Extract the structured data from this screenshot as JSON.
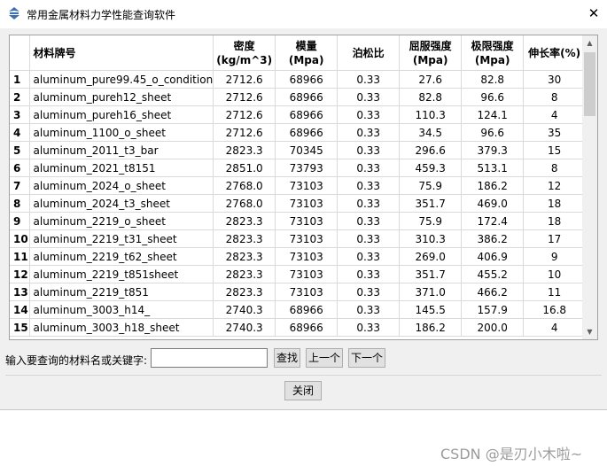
{
  "window": {
    "title": "常用金属材料力学性能查询软件",
    "close_glyph": "✕"
  },
  "table": {
    "headers": [
      "",
      "材料牌号",
      "密度\n(kg/m^3)",
      "模量\n(Mpa)",
      "泊松比",
      "屈服强度\n(Mpa)",
      "极限强度\n(Mpa)",
      "伸长率(%)"
    ],
    "rows": [
      [
        "1",
        "aluminum_pure99.45_o_condition",
        "2712.6",
        "68966",
        "0.33",
        "27.6",
        "82.8",
        "30"
      ],
      [
        "2",
        "aluminum_pureh12_sheet",
        "2712.6",
        "68966",
        "0.33",
        "82.8",
        "96.6",
        "8"
      ],
      [
        "3",
        "aluminum_pureh16_sheet",
        "2712.6",
        "68966",
        "0.33",
        "110.3",
        "124.1",
        "4"
      ],
      [
        "4",
        "aluminum_1100_o_sheet",
        "2712.6",
        "68966",
        "0.33",
        "34.5",
        "96.6",
        "35"
      ],
      [
        "5",
        "aluminum_2011_t3_bar",
        "2823.3",
        "70345",
        "0.33",
        "296.6",
        "379.3",
        "15"
      ],
      [
        "6",
        "aluminum_2021_t8151",
        "2851.0",
        "73793",
        "0.33",
        "459.3",
        "513.1",
        "8"
      ],
      [
        "7",
        "aluminum_2024_o_sheet",
        "2768.0",
        "73103",
        "0.33",
        "75.9",
        "186.2",
        "12"
      ],
      [
        "8",
        "aluminum_2024_t3_sheet",
        "2768.0",
        "73103",
        "0.33",
        "351.7",
        "469.0",
        "18"
      ],
      [
        "9",
        "aluminum_2219_o_sheet",
        "2823.3",
        "73103",
        "0.33",
        "75.9",
        "172.4",
        "18"
      ],
      [
        "10",
        "aluminum_2219_t31_sheet",
        "2823.3",
        "73103",
        "0.33",
        "310.3",
        "386.2",
        "17"
      ],
      [
        "11",
        "aluminum_2219_t62_sheet",
        "2823.3",
        "73103",
        "0.33",
        "269.0",
        "406.9",
        "9"
      ],
      [
        "12",
        "aluminum_2219_t851sheet",
        "2823.3",
        "73103",
        "0.33",
        "351.7",
        "455.2",
        "10"
      ],
      [
        "13",
        "aluminum_2219_t851",
        "2823.3",
        "73103",
        "0.33",
        "371.0",
        "466.2",
        "11"
      ],
      [
        "14",
        "aluminum_3003_h14_",
        "2740.3",
        "68966",
        "0.33",
        "145.5",
        "157.9",
        "16.8"
      ],
      [
        "15",
        "aluminum_3003_h18_sheet",
        "2740.3",
        "68966",
        "0.33",
        "186.2",
        "200.0",
        "4"
      ]
    ]
  },
  "search": {
    "label": "输入要查询的材料名或关键字:",
    "value": "",
    "find_button": "查找",
    "prev_button": "上一个",
    "next_button": "下一个"
  },
  "footer": {
    "close_button": "关闭"
  },
  "watermark": "CSDN @是刃小木啦~"
}
